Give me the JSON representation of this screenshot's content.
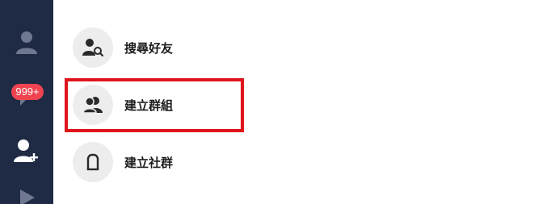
{
  "sidebar": {
    "badge_count": "999+",
    "icons": [
      "profile-icon",
      "chat-bubble-icon",
      "add-friend-icon",
      "play-icon"
    ]
  },
  "menu": {
    "items": [
      {
        "label": "搜尋好友",
        "icon": "search-friend-icon"
      },
      {
        "label": "建立群組",
        "icon": "group-icon"
      },
      {
        "label": "建立社群",
        "icon": "community-icon"
      }
    ]
  },
  "colors": {
    "sidebar_bg": "#1f2a44",
    "badge_bg": "#ef4450",
    "highlight": "#e0141b",
    "icon_circle": "#ededed"
  }
}
